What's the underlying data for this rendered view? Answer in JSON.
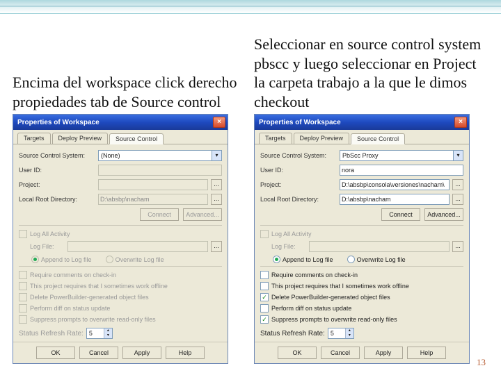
{
  "leftDesc": "Encima del workspace click derecho propiedades tab de Source control",
  "rightDesc": "Seleccionar en source control system pbscc y luego seleccionar en Project la carpeta trabajo a la que le dimos checkout",
  "dialogTitle": "Properties of Workspace",
  "tabs": {
    "targets": "Targets",
    "deploy": "Deploy Preview",
    "source": "Source Control"
  },
  "labels": {
    "scs": "Source Control System:",
    "userid": "User ID:",
    "project": "Project:",
    "localroot": "Local Root Directory:",
    "connect": "Connect",
    "advanced": "Advanced...",
    "logall": "Log All Activity",
    "logfile": "Log File:",
    "append": "Append to Log file",
    "overwrite": "Overwrite Log file",
    "req": "Require comments on check-in",
    "proj": "This project requires that I sometimes work offline",
    "del": "Delete PowerBuilder-generated object files",
    "perf": "Perform diff on status update",
    "supp": "Suppress prompts to overwrite read-only files",
    "refresh": "Status Refresh Rate:",
    "ok": "OK",
    "cancel": "Cancel",
    "apply": "Apply",
    "help": "Help"
  },
  "left": {
    "scs": "(None)",
    "userid": "",
    "project": "",
    "localroot": "D:\\absbp\\nacham",
    "refresh": "5"
  },
  "right": {
    "scs": "PbScc Proxy",
    "userid": "nora",
    "project": "D:\\absbp\\consola\\versiones\\nacham\\",
    "localroot": "D:\\absbp\\nacham",
    "refresh": "5"
  },
  "pageNum": "13"
}
